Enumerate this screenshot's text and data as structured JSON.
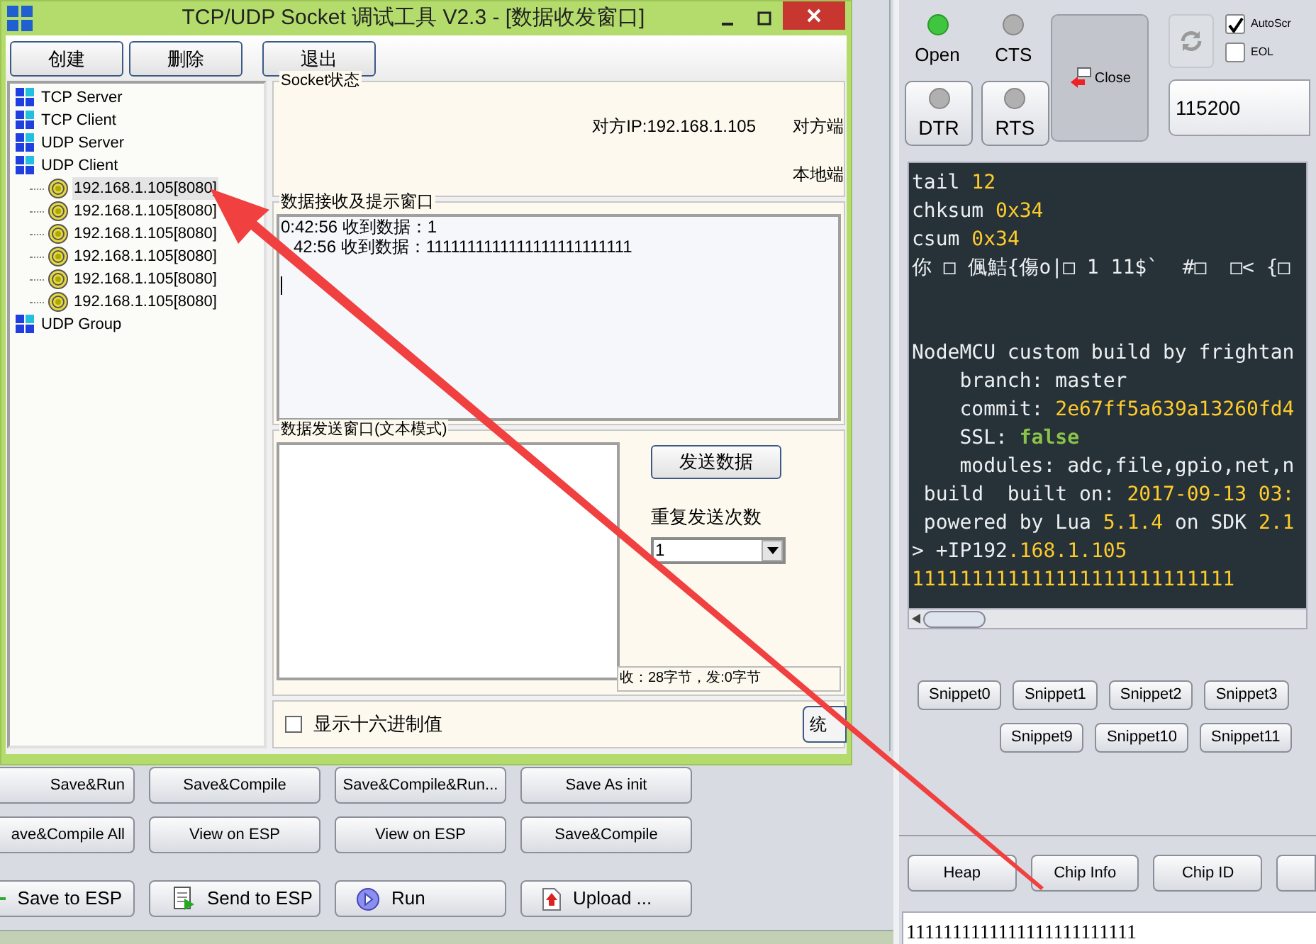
{
  "esplorer": {
    "button_rows": [
      [
        "Save&Run",
        "Save&Compile",
        "Save&Compile&Run...",
        "Save As init"
      ],
      [
        "ave&Compile All",
        "View on ESP",
        "View on ESP",
        "Save&Compile"
      ]
    ],
    "action_buttons": [
      {
        "label": "Save to ESP",
        "kind": "save"
      },
      {
        "label": "Send to ESP",
        "kind": "send"
      },
      {
        "label": "Run",
        "kind": "run"
      },
      {
        "label": "Upload ...",
        "kind": "upload"
      }
    ],
    "leds": [
      {
        "label": "Open",
        "on": true
      },
      {
        "label": "CTS",
        "on": false
      }
    ],
    "led_buttons": [
      {
        "label": "DTR",
        "on": false
      },
      {
        "label": "RTS",
        "on": false
      }
    ],
    "close_button": "Close",
    "options": [
      {
        "label": "AutoScr",
        "checked": true
      },
      {
        "label": "EOL",
        "checked": false
      }
    ],
    "baud": "115200",
    "terminal": [
      {
        "kind": "text",
        "segments": [
          {
            "t": "tail ",
            "kind": "plain"
          },
          {
            "t": "12",
            "kind": "number"
          }
        ]
      },
      {
        "kind": "text",
        "segments": [
          {
            "t": "chksum ",
            "kind": "plain"
          },
          {
            "t": "0x34",
            "kind": "number"
          }
        ]
      },
      {
        "kind": "text",
        "segments": [
          {
            "t": "csum ",
            "kind": "plain"
          },
          {
            "t": "0x34",
            "kind": "number"
          }
        ]
      },
      {
        "kind": "text",
        "segments": [
          {
            "t": "你 □ 偑鮚{傷o|□ 1 11$`  #□  □< {□",
            "kind": "plain"
          }
        ]
      },
      {
        "kind": "blank"
      },
      {
        "kind": "blank"
      },
      {
        "kind": "text",
        "segments": [
          {
            "t": "NodeMCU custom build by frightan",
            "kind": "plain"
          }
        ]
      },
      {
        "kind": "text",
        "segments": [
          {
            "t": "    branch: master",
            "kind": "plain"
          }
        ]
      },
      {
        "kind": "text",
        "segments": [
          {
            "t": "    commit: ",
            "kind": "plain"
          },
          {
            "t": "2e67ff5a639a13260fd4",
            "kind": "number"
          }
        ]
      },
      {
        "kind": "text",
        "segments": [
          {
            "t": "    SSL: ",
            "kind": "plain"
          },
          {
            "t": "false",
            "kind": "keyword"
          }
        ]
      },
      {
        "kind": "text",
        "segments": [
          {
            "t": "    modules: adc,file,gpio,net,n",
            "kind": "plain"
          }
        ]
      },
      {
        "kind": "text",
        "segments": [
          {
            "t": " build  built on: ",
            "kind": "plain"
          },
          {
            "t": "2017-09-13 03:",
            "kind": "number"
          }
        ]
      },
      {
        "kind": "text",
        "segments": [
          {
            "t": " powered by Lua ",
            "kind": "plain"
          },
          {
            "t": "5.1.4",
            "kind": "number"
          },
          {
            "t": " on SDK ",
            "kind": "plain"
          },
          {
            "t": "2.1",
            "kind": "number"
          }
        ]
      },
      {
        "kind": "text",
        "segments": [
          {
            "t": "> +IP192",
            "kind": "plain"
          },
          {
            "t": ".168.1.105",
            "kind": "number"
          }
        ]
      },
      {
        "kind": "text",
        "segments": [
          {
            "t": "111111111111111111111111111",
            "kind": "number"
          }
        ]
      }
    ],
    "snippet_rows": [
      [
        "Snippet0",
        "Snippet1",
        "Snippet2",
        "Snippet3"
      ],
      [
        "Snippet9",
        "Snippet10",
        "Snippet11"
      ]
    ],
    "info_buttons": [
      "Heap",
      "Chip Info",
      "Chip ID"
    ],
    "command_input": "1111111111111111111111111"
  },
  "window": {
    "title": "TCP/UDP Socket 调试工具 V2.3 - [数据收发窗口]",
    "buttons": [
      "创建",
      "删除",
      "退出"
    ],
    "tree": [
      {
        "label": "TCP Server"
      },
      {
        "label": "TCP Client"
      },
      {
        "label": "UDP Server"
      },
      {
        "label": "UDP Client",
        "children": [
          {
            "label": "192.168.1.105[8080]",
            "selected": true
          },
          {
            "label": "192.168.1.105[8080]",
            "selected": false
          },
          {
            "label": "192.168.1.105[8080]",
            "selected": false
          },
          {
            "label": "192.168.1.105[8080]",
            "selected": false
          },
          {
            "label": "192.168.1.105[8080]",
            "selected": false
          },
          {
            "label": "192.168.1.105[8080]",
            "selected": false
          }
        ]
      },
      {
        "label": "UDP Group"
      }
    ],
    "socket_status": {
      "title": "Socket状态",
      "remote_ip": "对方IP:192.168.1.105",
      "remote_port": "对方端",
      "local_port": "本地端"
    },
    "receive": {
      "title": "数据接收及提示窗口",
      "lines": [
        "0:42:56 收到数据：1",
        "42:56 收到数据：1111111111111111111111111"
      ]
    },
    "send": {
      "title": "数据发送窗口(文本模式)",
      "send_button": "发送数据",
      "repeat_label": "重复发送次数",
      "repeat_value": "1",
      "counter": "收：28字节，发:0字节"
    },
    "hex_option": {
      "label": "显示十六进制值",
      "checked": false
    },
    "cut_button": "统"
  }
}
